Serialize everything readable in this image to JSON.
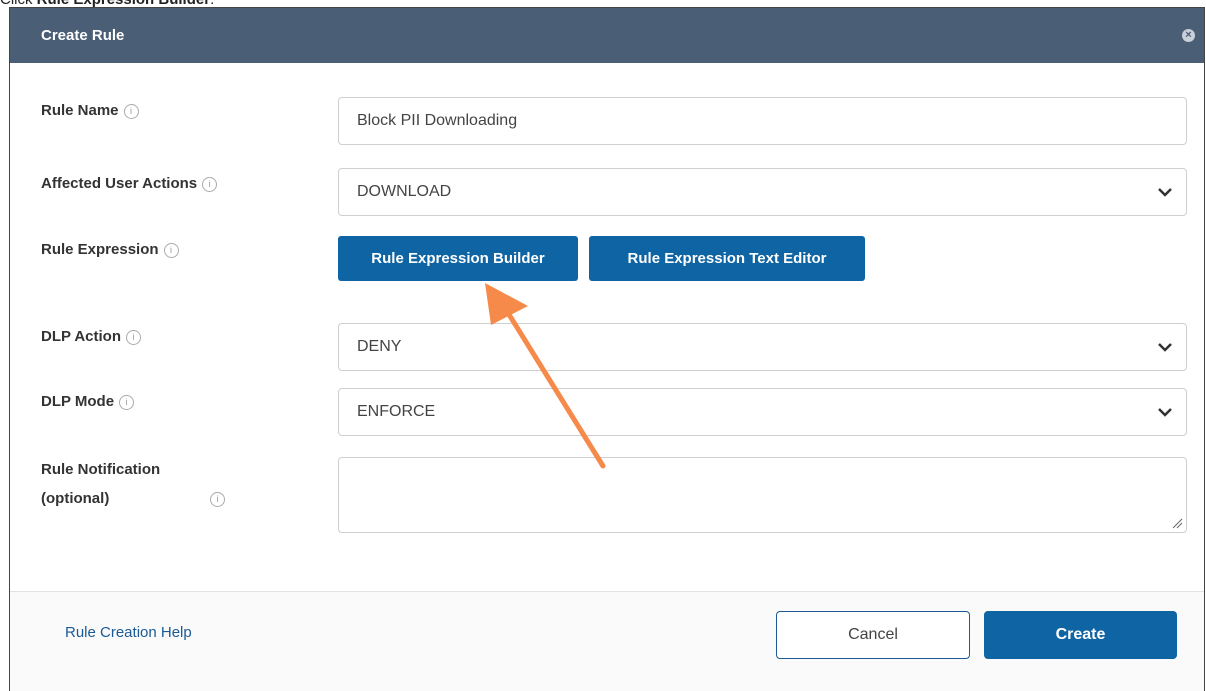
{
  "caption": {
    "prefix": "Click ",
    "bold": "Rule Expression Builder",
    "suffix": "."
  },
  "dialog": {
    "title": "Create Rule",
    "close_icon": "close-icon"
  },
  "fields": {
    "rule_name": {
      "label": "Rule Name",
      "value": "Block PII Downloading"
    },
    "affected_user_actions": {
      "label": "Affected User Actions",
      "value": "DOWNLOAD"
    },
    "rule_expression": {
      "label": "Rule Expression",
      "builder_button": "Rule Expression Builder",
      "text_editor_button": "Rule Expression Text Editor"
    },
    "dlp_action": {
      "label": "DLP Action",
      "value": "DENY"
    },
    "dlp_mode": {
      "label": "DLP Mode",
      "value": "ENFORCE"
    },
    "rule_notification": {
      "label_line1": "Rule Notification",
      "label_line2": "(optional)",
      "value": ""
    }
  },
  "footer": {
    "help_link": "Rule Creation Help",
    "cancel_label": "Cancel",
    "create_label": "Create"
  },
  "colors": {
    "titlebar": "#4a5e76",
    "primary_button": "#0f64a4",
    "annotation_arrow": "#f58a4a"
  }
}
